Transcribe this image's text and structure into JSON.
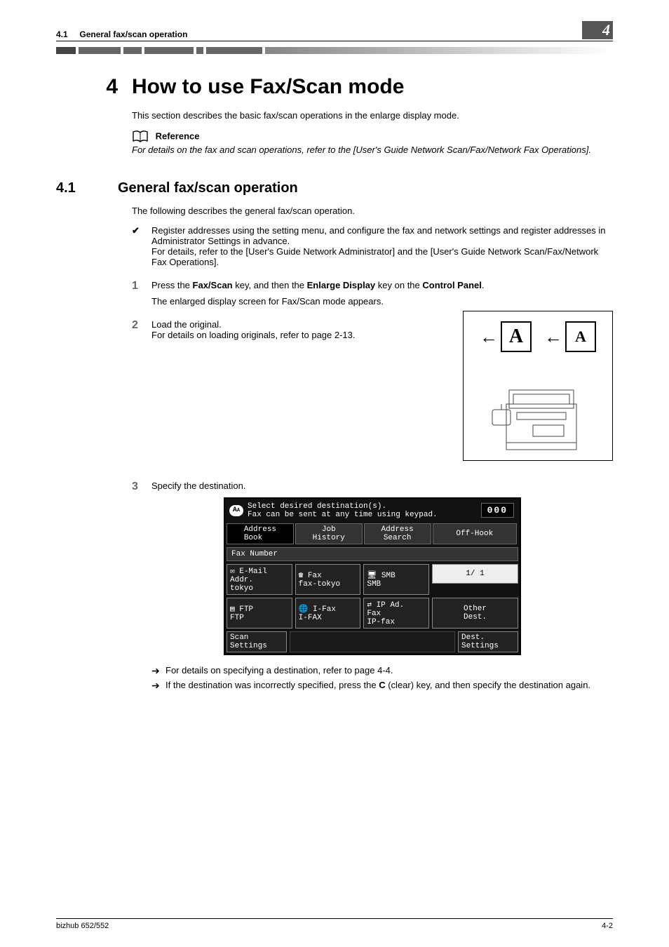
{
  "header": {
    "section_ref": "4.1",
    "section_name": "General fax/scan operation",
    "chapter_badge": "4"
  },
  "chapter": {
    "number": "4",
    "title": "How to use Fax/Scan mode"
  },
  "intro": "This section describes the basic fax/scan operations in the enlarge display mode.",
  "reference": {
    "label": "Reference",
    "text": "For details on the fax and scan operations, refer to the [User's Guide Network Scan/Fax/Network Fax Operations]."
  },
  "section41": {
    "number": "4.1",
    "title": "General fax/scan operation",
    "lead": "The following describes the general fax/scan operation.",
    "prereq": {
      "line1": "Register addresses using the setting menu, and configure the fax and network settings and register addresses in Administrator Settings in advance.",
      "line2": "For details, refer to the [User's Guide Network Administrator] and the [User's Guide Network Scan/Fax/Network Fax Operations]."
    },
    "step1": {
      "num": "1",
      "pre": "Press the ",
      "k1": "Fax/Scan",
      "mid1": " key, and then the ",
      "k2": "Enlarge Display",
      "mid2": " key on the ",
      "k3": "Control Panel",
      "post": ".",
      "note": "The enlarged display screen for Fax/Scan mode appears."
    },
    "step2": {
      "num": "2",
      "line1": "Load the original.",
      "line2": "For details on loading originals, refer to page 2-13."
    },
    "figure": {
      "a1_size": "28px",
      "a2_size": "22px"
    },
    "step3": {
      "num": "3",
      "text": "Specify the destination.",
      "bullet1": "For details on specifying a destination, refer to page 4-4.",
      "bullet2_pre": "If the destination was incorrectly specified, press the ",
      "bullet2_key": "C",
      "bullet2_post": " (clear) key, and then specify the destination again."
    }
  },
  "screen": {
    "icon_text": "A",
    "msg1": "Select desired destination(s).",
    "msg2": "Fax can be sent at any time using keypad.",
    "count": "000",
    "tabs": {
      "addr_book": "Address\nBook",
      "job_hist": "Job\nHistory",
      "addr_search": "Address\nSearch",
      "off_hook": "Off-Hook"
    },
    "bar": "Fax Number",
    "dest": {
      "email_t": "E-Mail\nAddr.",
      "email_b": "tokyo",
      "fax_t": "Fax",
      "fax_b": "fax-tokyo",
      "smb_t": "SMB",
      "smb_b": "SMB",
      "ftp_t": "FTP",
      "ftp_b": "FTP",
      "ifax_t": "I-Fax",
      "ifax_b": "I-FAX",
      "ip_t": "IP Ad.\nFax",
      "ip_b": "IP-fax"
    },
    "page": "1/  1",
    "other_dest": "Other\nDest.",
    "scan_settings": "Scan\nSettings",
    "dest_settings": "Dest.\nSettings"
  },
  "footer": {
    "left": "bizhub 652/552",
    "right": "4-2"
  }
}
